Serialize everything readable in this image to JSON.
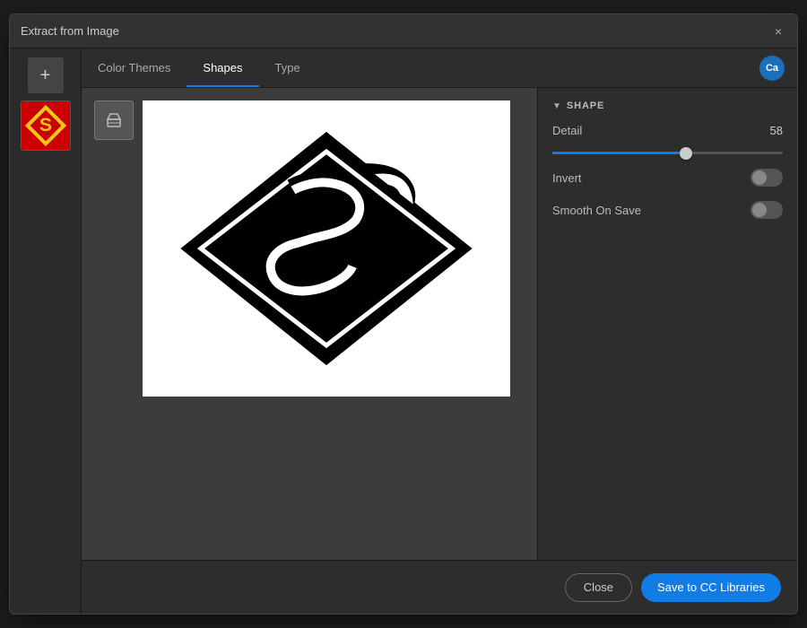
{
  "dialog": {
    "title": "Extract from Image",
    "close_label": "×"
  },
  "tabs": [
    {
      "id": "color-themes",
      "label": "Color Themes",
      "active": false
    },
    {
      "id": "shapes",
      "label": "Shapes",
      "active": true
    },
    {
      "id": "type",
      "label": "Type",
      "active": false
    }
  ],
  "user_badge": "Ca",
  "shape_section": {
    "header": "SHAPE",
    "detail_label": "Detail",
    "detail_value": "58",
    "slider_percent": 58,
    "invert_label": "Invert",
    "smooth_label": "Smooth On Save"
  },
  "footer": {
    "close_label": "Close",
    "save_label": "Save to CC Libraries"
  }
}
